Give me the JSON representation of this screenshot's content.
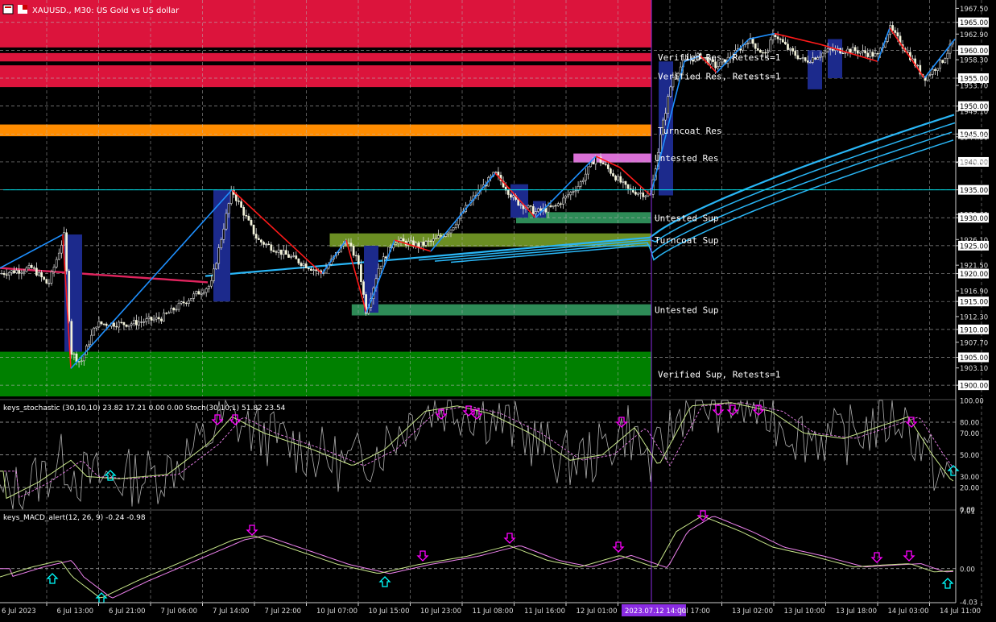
{
  "header": {
    "symbol": "XAUUSD.",
    "timeframe": "M30",
    "description": "US Gold vs US dollar",
    "title_text": "XAUUSD., M30:  US Gold vs US dollar"
  },
  "colors": {
    "background": "#000000",
    "grid": "#b4b4b4",
    "resistance_red": "#dc143c",
    "resistance_orange": "#ff8c00",
    "untested_res": "#da70d6",
    "support_green": "#008000",
    "untested_sup": "#2e8b57",
    "turncoat_sup": "#6b8e23",
    "zigzag_up": "#1e90ff",
    "zigzag_down": "#ff1a1a",
    "ma": "#29b6f6",
    "ma_red": "#e0245e",
    "stoch_main": "#b0b0b0",
    "stoch_signal": "#c8e68a",
    "stoch_signal2": "#ee82ee",
    "arrow_up": "#00ffff",
    "arrow_down": "#ff00ff",
    "separator": "#8a2be2"
  },
  "main": {
    "price_axis": [
      "1967.50",
      "1965.00",
      "1962.90",
      "1960.00",
      "1958.30",
      "1955.00",
      "1953.70",
      "1950.00",
      "1949.10",
      "1945.00",
      "1944.50",
      "1940.00",
      "1939.90",
      "1935.00",
      "1930.60",
      "1930.00",
      "1926.10",
      "1925.00",
      "1921.50",
      "1920.00",
      "1916.90",
      "1915.00",
      "1912.30",
      "1910.00",
      "1907.70",
      "1905.00",
      "1903.10",
      "1900.00"
    ],
    "highlighted_prices": [
      "1965.00",
      "1960.00",
      "1955.00",
      "1950.00",
      "1945.00",
      "1940.00",
      "1935.00",
      "1930.00",
      "1925.00",
      "1920.00",
      "1915.00",
      "1910.00",
      "1905.00",
      "1900.00"
    ],
    "price_range": [
      1898,
      1969
    ],
    "zones": [
      {
        "label": "",
        "low": 1960.5,
        "high": 1969.0,
        "color_key": "resistance_red",
        "full": true
      },
      {
        "label": "Verified Res, Retests=1",
        "low": 1958.0,
        "high": 1959.5,
        "color_key": "resistance_red",
        "full": true
      },
      {
        "label": "Verified Res, Retests=1",
        "low": 1953.4,
        "high": 1957.3,
        "color_key": "resistance_red",
        "full": true
      },
      {
        "label": "Turncoat Res",
        "low": 1944.6,
        "high": 1946.7,
        "color_key": "resistance_orange",
        "full": true
      },
      {
        "label": "Untested Res",
        "low": 1939.9,
        "high": 1941.5,
        "color_key": "untested_res",
        "from": 0.6,
        "label_offset": 5
      },
      {
        "label": "Untested Sup",
        "low": 1929.0,
        "high": 1931.0,
        "color_key": "untested_sup",
        "from": 0.54
      },
      {
        "label": "Turncoat Sup",
        "low": 1924.8,
        "high": 1927.2,
        "color_key": "turncoat_sup",
        "from": 0.345
      },
      {
        "label": "Untested Sup",
        "low": 1912.5,
        "high": 1914.5,
        "color_key": "untested_sup",
        "from": 0.368
      },
      {
        "label": "Verified Sup, Retests=1",
        "low": 1898.0,
        "high": 1906.0,
        "color_key": "support_green",
        "full": true
      }
    ],
    "horizontal_line_price": 1935.0
  },
  "stoch": {
    "label": "keys_stochastic (30,10,10) 23.82 17.21 0.00 0.00 Stoch(30,10,1) 51.82 23.54",
    "axis": [
      "100.00",
      "80.00",
      "70.00",
      "50.00",
      "30.00",
      "20.00",
      "0.00"
    ],
    "range": [
      0,
      100
    ]
  },
  "macd": {
    "label": "keys_MACD_alert(12, 26, 9) -0.24 -0.98",
    "axis": [
      "7.01",
      "0.00",
      "-4.03"
    ],
    "range": [
      -4.03,
      7.01
    ]
  },
  "time_axis": [
    "6 Jul 2023",
    "6 Jul 13:00",
    "6 Jul 21:00",
    "7 Jul 06:00",
    "7 Jul 14:00",
    "7 Jul 22:00",
    "10 Jul 07:00",
    "10 Jul 15:00",
    "10 Jul 23:00",
    "11 Jul 08:00",
    "11 Jul 16:00",
    "12 Jul 01:00",
    "2023.07.12 14:00",
    "Jul 17:00",
    "13 Jul 02:00",
    "13 Jul 10:00",
    "13 Jul 18:00",
    "14 Jul 03:00",
    "14 Jul 11:00"
  ],
  "cursor_time_label": "2023.07.12 14:00"
}
